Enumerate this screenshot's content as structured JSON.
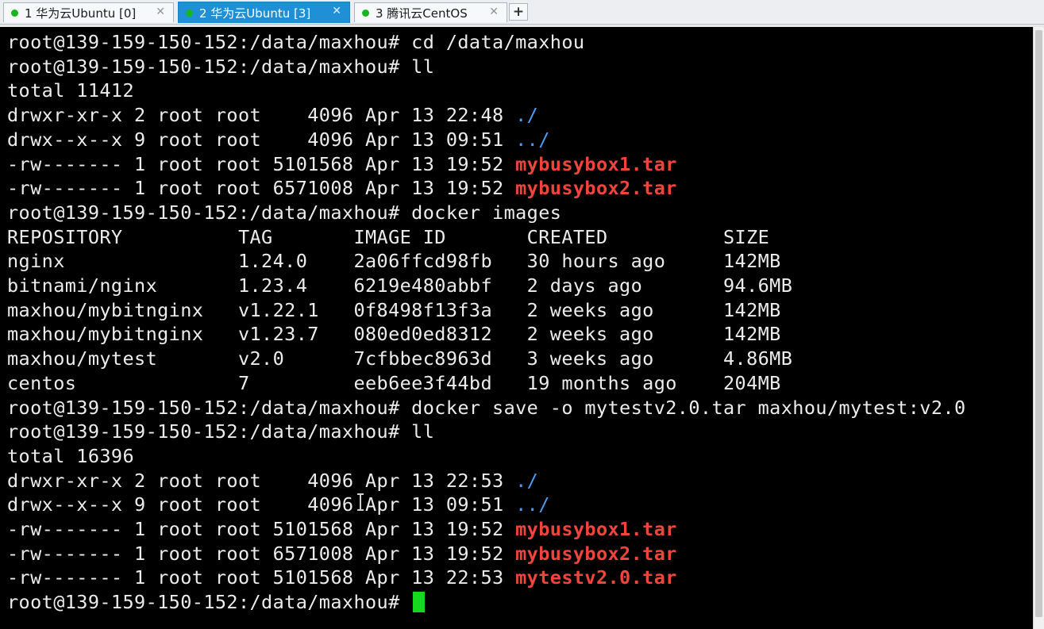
{
  "tabs": [
    {
      "label": "1 华为云Ubuntu [0]",
      "active": false,
      "close": "✕"
    },
    {
      "label": "2 华为云Ubuntu [3]",
      "active": true,
      "close": "✕"
    },
    {
      "label": "3 腾讯云CentOS",
      "active": false,
      "close": "✕"
    }
  ],
  "new_tab_label": "+",
  "colors": {
    "status_dot": "#18b51c",
    "active_tab": "#1f8fd6",
    "directory": "#4a9cf5",
    "archive": "#f1453c",
    "cursor": "#17d81e"
  },
  "terminal": {
    "lines": [
      {
        "text": "root@139-159-150-152:/data/maxhou# cd /data/maxhou",
        "tail": ""
      },
      {
        "text": "root@139-159-150-152:/data/maxhou# ll",
        "tail": ""
      },
      {
        "text": "total 11412",
        "tail": ""
      },
      {
        "text": "drwxr-xr-x 2 root root    4096 Apr 13 22:48 ",
        "tail": "./"
      },
      {
        "text": "drwx--x--x 9 root root    4096 Apr 13 09:51 ",
        "tail": "../"
      },
      {
        "text": "-rw------- 1 root root 5101568 Apr 13 19:52 ",
        "tail": "mybusybox1.tar"
      },
      {
        "text": "-rw------- 1 root root 6571008 Apr 13 19:52 ",
        "tail": "mybusybox2.tar"
      },
      {
        "text": "root@139-159-150-152:/data/maxhou# docker images",
        "tail": ""
      },
      {
        "text": "REPOSITORY          TAG       IMAGE ID       CREATED          SIZE",
        "tail": ""
      },
      {
        "text": "nginx               1.24.0    2a06ffcd98fb   30 hours ago     142MB",
        "tail": ""
      },
      {
        "text": "bitnami/nginx       1.23.4    6219e480abbf   2 days ago       94.6MB",
        "tail": ""
      },
      {
        "text": "maxhou/mybitnginx   v1.22.1   0f8498f13f3a   2 weeks ago      142MB",
        "tail": ""
      },
      {
        "text": "maxhou/mybitnginx   v1.23.7   080ed0ed8312   2 weeks ago      142MB",
        "tail": ""
      },
      {
        "text": "maxhou/mytest       v2.0      7cfbbec8963d   3 weeks ago      4.86MB",
        "tail": ""
      },
      {
        "text": "centos              7         eeb6ee3f44bd   19 months ago    204MB",
        "tail": ""
      },
      {
        "text": "root@139-159-150-152:/data/maxhou# docker save -o mytestv2.0.tar maxhou/mytest:v2.0",
        "tail": ""
      },
      {
        "text": "root@139-159-150-152:/data/maxhou# ll",
        "tail": ""
      },
      {
        "text": "total 16396",
        "tail": ""
      },
      {
        "text": "drwxr-xr-x 2 root root    4096 Apr 13 22:53 ",
        "tail": "./"
      },
      {
        "text": "drwx--x--x 9 root root    4096 Apr 13 09:51 ",
        "tail": "../"
      },
      {
        "text": "-rw------- 1 root root 5101568 Apr 13 19:52 ",
        "tail": "mybusybox1.tar"
      },
      {
        "text": "-rw------- 1 root root 6571008 Apr 13 19:52 ",
        "tail": "mybusybox2.tar"
      },
      {
        "text": "-rw------- 1 root root 5101568 Apr 13 22:53 ",
        "tail": "mytestv2.0.tar"
      },
      {
        "text": "root@139-159-150-152:/data/maxhou# ",
        "tail": ""
      }
    ]
  }
}
